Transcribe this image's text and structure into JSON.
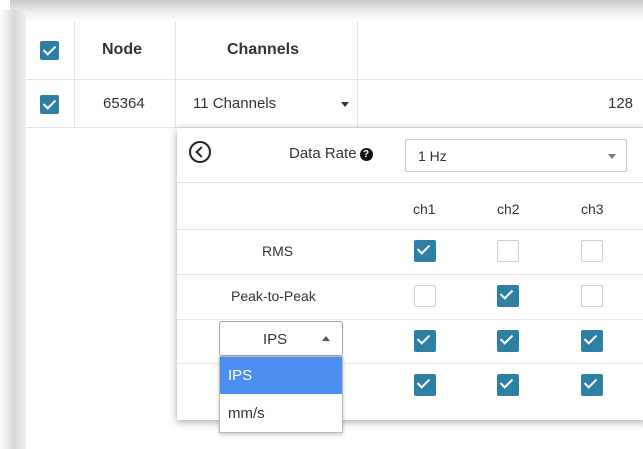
{
  "table": {
    "headers": {
      "node": "Node",
      "channels": "Channels"
    },
    "row": {
      "node": "65364",
      "channels": "11 Channels",
      "value": "128"
    }
  },
  "panel": {
    "data_rate_label": "Data Rate",
    "help_icon_glyph": "?",
    "data_rate_value": "1 Hz",
    "channel_headers": [
      "ch1",
      "ch2",
      "ch3"
    ],
    "rows": [
      {
        "label": "RMS",
        "checks": [
          true,
          false,
          false
        ]
      },
      {
        "label": "Peak-to-Peak",
        "checks": [
          false,
          true,
          false
        ]
      },
      {
        "label": "IPS",
        "checks": [
          true,
          true,
          true
        ]
      },
      {
        "label": "",
        "checks": [
          true,
          true,
          true
        ]
      }
    ],
    "unit_select": {
      "value": "IPS",
      "options": [
        "IPS",
        "mm/s"
      ]
    }
  },
  "colors": {
    "checkbox_checked": "#2d7fa3",
    "dropdown_highlight": "#4d8ff0"
  }
}
